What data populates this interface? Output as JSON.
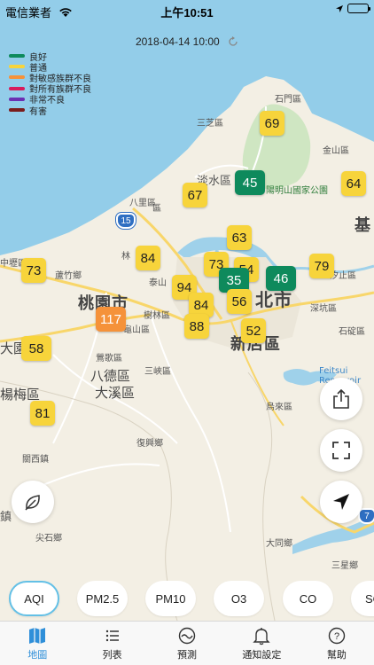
{
  "status_bar": {
    "carrier": "電信業者",
    "time": "上午10:51"
  },
  "timestamp": "2018-04-14 10:00",
  "legend": [
    {
      "label": "良好",
      "color": "#0e8a5c"
    },
    {
      "label": "普通",
      "color": "#f7d43b"
    },
    {
      "label": "對敏感族群不良",
      "color": "#f5923a"
    },
    {
      "label": "對所有族群不良",
      "color": "#d81b5b"
    },
    {
      "label": "非常不良",
      "color": "#6b2fb3"
    },
    {
      "label": "有害",
      "color": "#7a1c1c"
    }
  ],
  "map": {
    "places": {
      "shimen": "石門區",
      "sanzhi": "三芝區",
      "jinshan": "金山區",
      "tamsui": "淡水區",
      "yangmingshan": "陽明山國家公園",
      "bali": "八里區",
      "keelung": "基",
      "linkou": "林",
      "taishan": "泰山",
      "luzhu": "蘆竹鄉",
      "taoyuan": "桃園市",
      "shulin": "樹林區",
      "guishan": "龜山區",
      "taipei": "北市",
      "xindian": "新店區",
      "shenkeng": "深坑區",
      "xizhi": "汐止區",
      "shiding": "石碇區",
      "feitsui": "Feitsui Reservoir",
      "wulai": "烏來區",
      "yingge": "鶯歌區",
      "bade": "八德區",
      "daxi": "大溪區",
      "sanxia": "三峽區",
      "yangmei": "楊梅區",
      "guanxi": "關西鎮",
      "fuxing": "復興鄉",
      "jianshi": "尖石鄉",
      "datong": "大同鄉",
      "sanxing": "三星鄉",
      "left_a": "大園區",
      "left_b": "中壢區",
      "left_c": "鎮",
      "left_top": "區",
      "route15": "15",
      "route7": "7"
    },
    "markers": [
      {
        "value": "69",
        "level": "moderate"
      },
      {
        "value": "45",
        "level": "good"
      },
      {
        "value": "64",
        "level": "moderate"
      },
      {
        "value": "67",
        "level": "moderate"
      },
      {
        "value": "63",
        "level": "moderate"
      },
      {
        "value": "73",
        "level": "moderate"
      },
      {
        "value": "84",
        "level": "moderate"
      },
      {
        "value": "73",
        "level": "moderate"
      },
      {
        "value": "54",
        "level": "moderate"
      },
      {
        "value": "79",
        "level": "moderate"
      },
      {
        "value": "46",
        "level": "good"
      },
      {
        "value": "35",
        "level": "good"
      },
      {
        "value": "94",
        "level": "moderate"
      },
      {
        "value": "84",
        "level": "moderate"
      },
      {
        "value": "56",
        "level": "moderate"
      },
      {
        "value": "117",
        "level": "usg"
      },
      {
        "value": "88",
        "level": "moderate"
      },
      {
        "value": "52",
        "level": "moderate"
      },
      {
        "value": "58",
        "level": "moderate"
      },
      {
        "value": "81",
        "level": "moderate"
      }
    ]
  },
  "buttons": {
    "share_icon": "share-icon",
    "fullscreen_icon": "fullscreen-icon",
    "locate_icon": "location-arrow-icon",
    "leaf_icon": "leaf-icon"
  },
  "pollutants": [
    {
      "label": "AQI",
      "active": true
    },
    {
      "label": "PM2.5"
    },
    {
      "label": "PM10"
    },
    {
      "label": "O3"
    },
    {
      "label": "CO"
    },
    {
      "label": "SO"
    }
  ],
  "tabs": [
    {
      "label": "地圖",
      "icon": "map-icon",
      "active": true
    },
    {
      "label": "列表",
      "icon": "list-icon"
    },
    {
      "label": "預測",
      "icon": "forecast-icon"
    },
    {
      "label": "通知設定",
      "icon": "bell-icon"
    },
    {
      "label": "幫助",
      "icon": "help-icon"
    }
  ]
}
